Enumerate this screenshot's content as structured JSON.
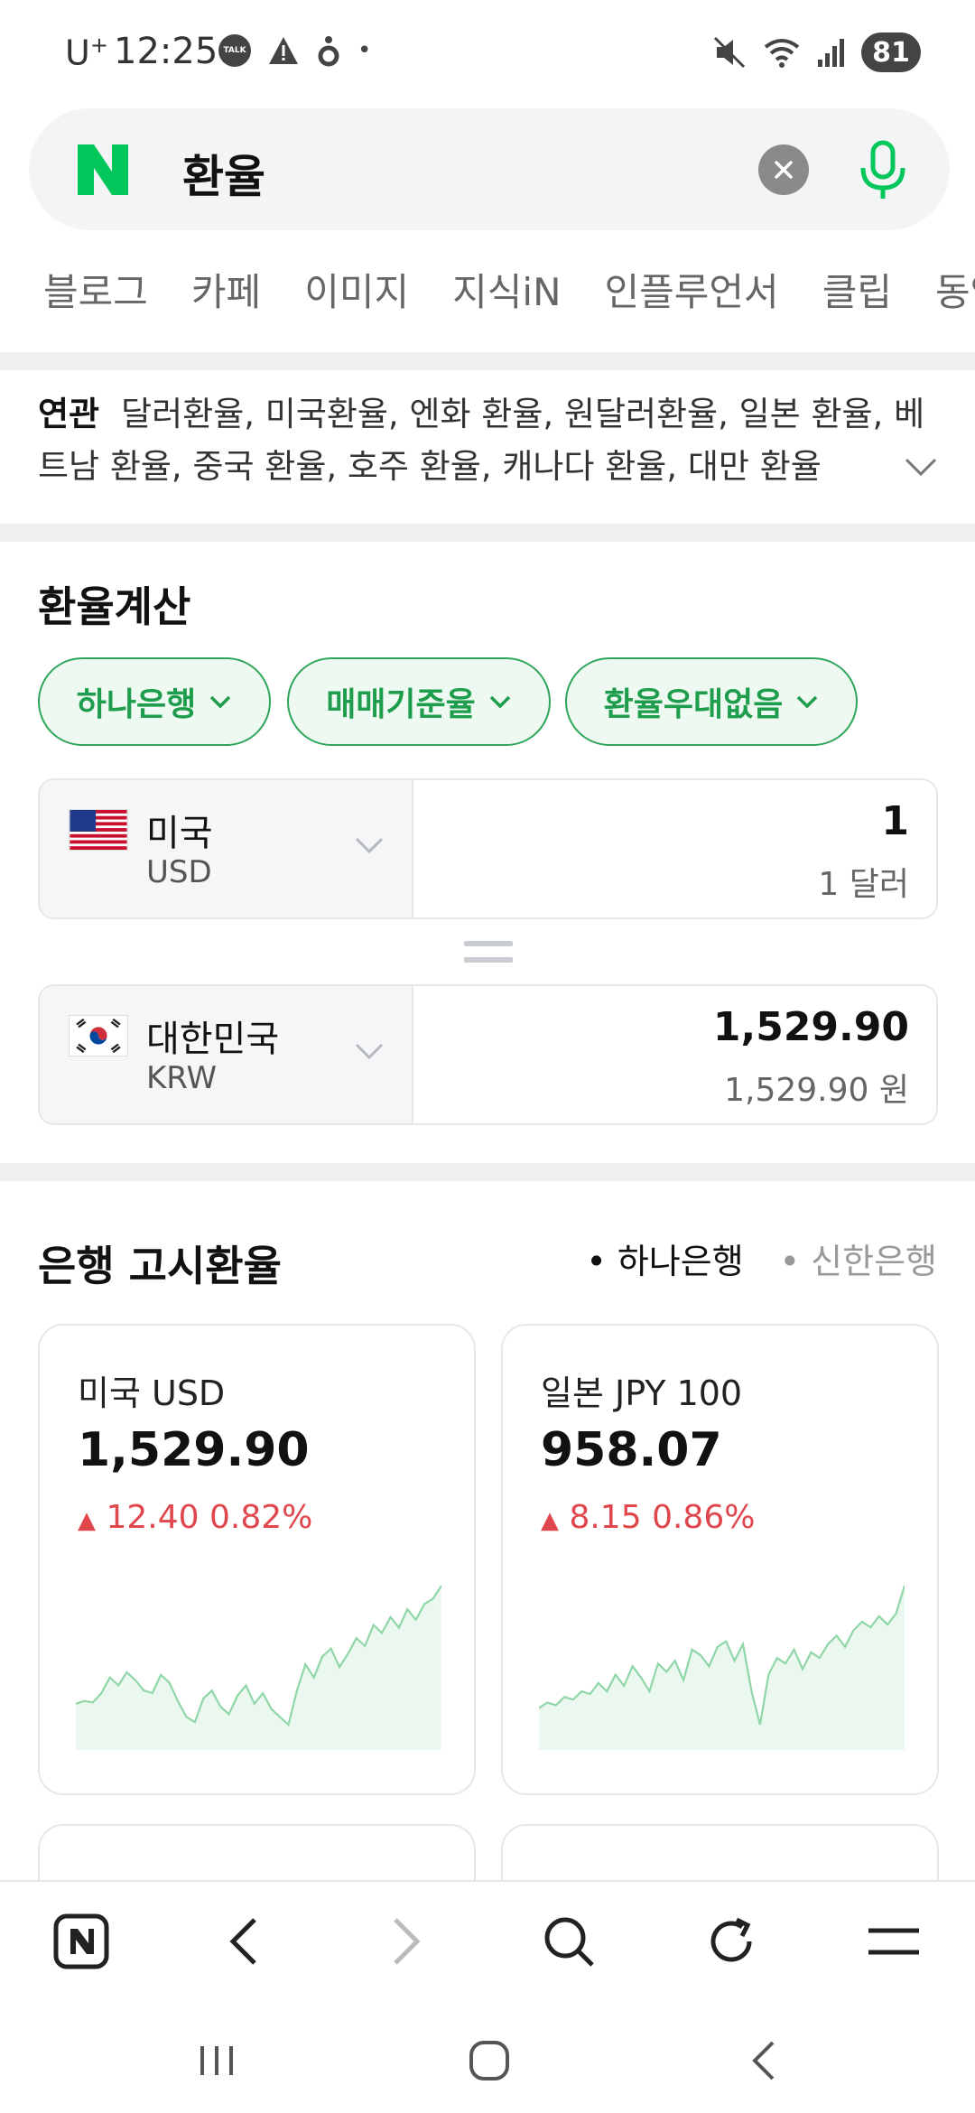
{
  "status_bar": {
    "carrier_prefix": "U",
    "carrier_sup": "+",
    "time": "12:25",
    "talk_badge": "TALK",
    "dot": "•",
    "battery": "81"
  },
  "search": {
    "logo": "N",
    "query": "환율"
  },
  "tabs": [
    "블로그",
    "카페",
    "이미지",
    "지식iN",
    "인플루언서",
    "클립",
    "동영상"
  ],
  "related": {
    "label": "연관",
    "text": "달러환율, 미국환율, 엔화 환율, 원달러환율, 일본 환율, 베트남 환율, 중국 환율, 호주 환율, 캐나다 환율, 대만 환율"
  },
  "calculator": {
    "title": "환율계산",
    "filters": [
      "하나은행",
      "매매기준율",
      "환율우대없음"
    ],
    "from": {
      "country": "미국",
      "code": "USD",
      "value": "1",
      "sub": "1 달러"
    },
    "to": {
      "country": "대한민국",
      "code": "KRW",
      "value": "1,529.90",
      "sub": "1,529.90 원"
    }
  },
  "bank_rates": {
    "title": "은행 고시환율",
    "banks": [
      "하나은행",
      "신한은행"
    ],
    "active_bank": "하나은행",
    "cards": [
      {
        "name": "미국 USD",
        "value": "1,529.90",
        "change": "12.40",
        "percent": "0.82%",
        "trend": [
          20,
          22,
          21,
          28,
          40,
          34,
          44,
          38,
          30,
          28,
          42,
          36,
          22,
          10,
          6,
          24,
          30,
          18,
          12,
          26,
          34,
          20,
          28,
          16,
          10,
          4,
          30,
          50,
          40,
          56,
          62,
          48,
          58,
          70,
          64,
          80,
          74,
          86,
          78,
          92,
          84,
          96,
          100,
          110
        ]
      },
      {
        "name": "일본 JPY 100",
        "value": "958.07",
        "change": "8.15",
        "percent": "0.86%",
        "trend": [
          28,
          32,
          30,
          36,
          34,
          40,
          38,
          46,
          40,
          52,
          44,
          58,
          50,
          40,
          60,
          54,
          62,
          48,
          70,
          66,
          58,
          72,
          76,
          62,
          74,
          40,
          16,
          52,
          64,
          60,
          70,
          56,
          68,
          64,
          74,
          80,
          72,
          84,
          90,
          86,
          94,
          88,
          96,
          116
        ]
      }
    ],
    "colors": {
      "up": "#e0474d",
      "chart_line": "#8fd6a8",
      "chart_fill": "#e6f6ec"
    }
  },
  "browser_bar": {
    "icons": [
      "naver-home-icon",
      "back-icon",
      "forward-icon",
      "search-icon",
      "refresh-icon",
      "menu-icon"
    ]
  },
  "nav_bar": {
    "icons": [
      "recents-icon",
      "home-icon",
      "back-icon"
    ]
  }
}
